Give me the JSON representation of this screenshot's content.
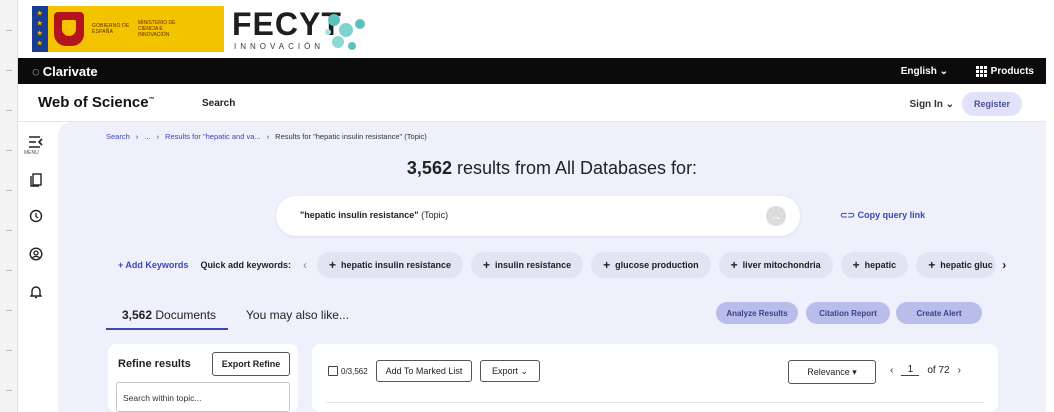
{
  "banner": {
    "gov_text": "GOBIERNO DE ESPAÑA",
    "ministry_text": "MINISTERIO DE CIENCIA E INNOVACIÓN",
    "fecyt": "FECYT",
    "fecyt_sub": "INNOVACIÓN",
    "colors": {
      "gov_yellow": "#f4c300",
      "fecyt_teal": "#5bc2c0"
    }
  },
  "topbar": {
    "brand": "Clarivate",
    "language": "English ⌄",
    "products": "Products"
  },
  "header": {
    "logo": "Web of Science",
    "logo_tm": "™",
    "search": "Search",
    "sign_in": "Sign In ⌄",
    "register": "Register"
  },
  "rail": {
    "menu_label": "MENU",
    "icons": [
      "menu-icon",
      "bookmark-icon",
      "history-icon",
      "account-icon",
      "bell-icon"
    ]
  },
  "breadcrumb": {
    "search": "Search",
    "ellipsis": "...",
    "prev": "Results for \"hepatic and va...",
    "current": "Results for \"hepatic insulin resistance\" (Topic)"
  },
  "results": {
    "count": "3,562",
    "text": " results from All Databases for:"
  },
  "query": {
    "term": "\"hepatic insulin resistance\"",
    "field": " (Topic)",
    "copy_link": "Copy query link"
  },
  "keywords": {
    "add": "+ Add Keywords",
    "quick_label": "Quick add keywords:",
    "chips": [
      "hepatic insulin resistance",
      "insulin resistance",
      "glucose production",
      "liver mitochondria",
      "hepatic",
      "hepatic gluc"
    ]
  },
  "tabs": {
    "documents_count": "3,562",
    "documents_label": " Documents",
    "also_like": "You may also like..."
  },
  "actions": {
    "analyze": "Analyze Results",
    "citation": "Citation Report",
    "alert": "Create Alert"
  },
  "refine": {
    "title": "Refine results",
    "export": "Export Refine",
    "search_within": "Search within topic..."
  },
  "toolbar": {
    "selected": "0/3,562",
    "marked_list": "Add To Marked List",
    "export": "Export ⌄",
    "sort": "Relevance ▾",
    "page": "1",
    "of_pages": "of 72"
  },
  "colors": {
    "accent": "#3a47b8",
    "panel_bg": "#eef1fb",
    "chip_bg": "#e1e4f2",
    "action_bg": "#b9bdea"
  }
}
